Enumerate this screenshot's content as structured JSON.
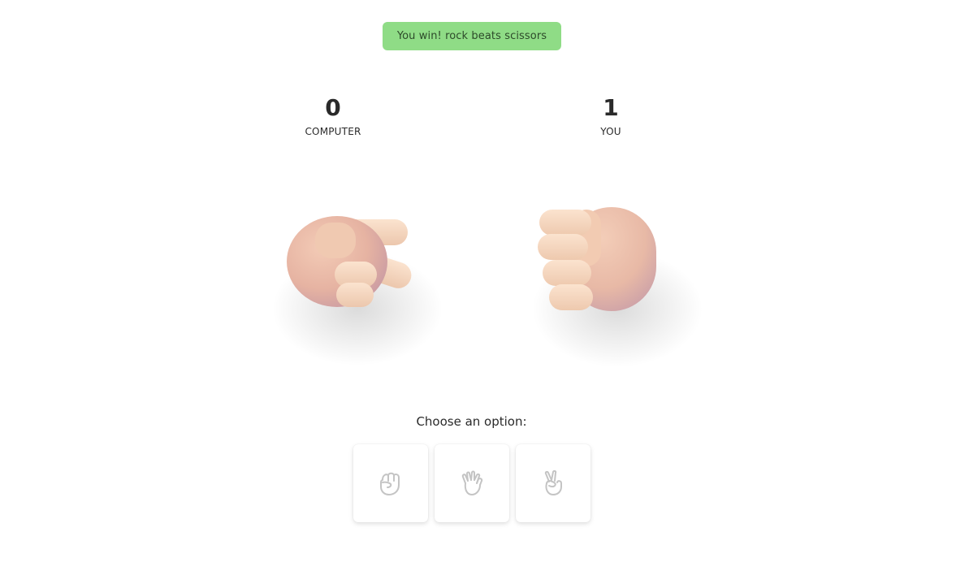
{
  "result_message": "You win! rock beats scissors",
  "scores": {
    "computer": {
      "value": "0",
      "label": "COMPUTER"
    },
    "you": {
      "value": "1",
      "label": "YOU"
    }
  },
  "hands": {
    "computer": "scissors",
    "you": "rock"
  },
  "prompt": "Choose an option:",
  "options": [
    {
      "icon": "rock-icon"
    },
    {
      "icon": "paper-icon"
    },
    {
      "icon": "scissors-icon"
    }
  ],
  "colors": {
    "banner": "#8fdc86",
    "skin_light": "#f5d5bd",
    "skin_pink": "#e8b8a6",
    "icon_stroke": "#c4c4c4"
  }
}
